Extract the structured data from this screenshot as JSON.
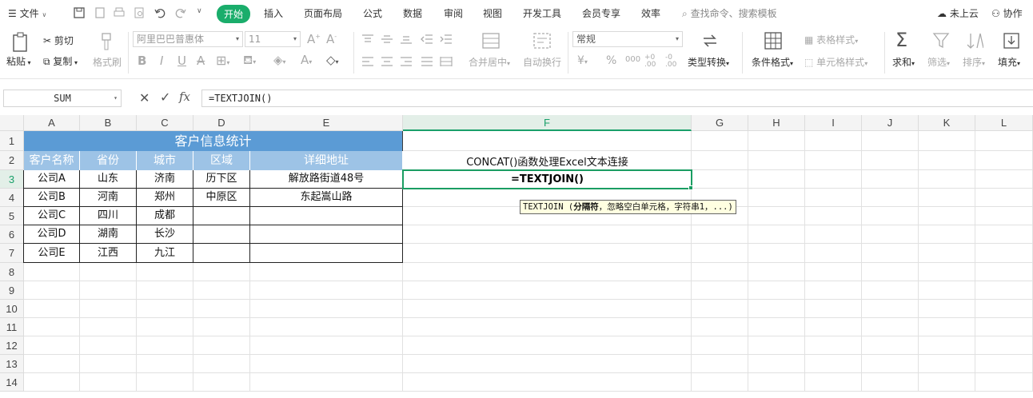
{
  "menubar": {
    "file_label": "文件",
    "tabs": [
      "开始",
      "插入",
      "页面布局",
      "公式",
      "数据",
      "审阅",
      "视图",
      "开发工具",
      "会员专享",
      "效率"
    ],
    "active_tab": "开始",
    "search_placeholder": "查找命令、搜索模板",
    "cloud_label": "未上云",
    "collab_label": "协作"
  },
  "ribbon": {
    "paste": "粘贴",
    "cut": "剪切",
    "copy": "复制",
    "format_painter": "格式刷",
    "font_name": "阿里巴巴普惠体",
    "font_size": "11",
    "merge_center": "合并居中",
    "wrap_text": "自动换行",
    "number_format": "常规",
    "type_convert": "类型转换",
    "cond_format": "条件格式",
    "table_style": "表格样式",
    "cell_style": "单元格样式",
    "sum": "求和",
    "filter": "筛选",
    "sort": "排序",
    "fill": "填充"
  },
  "formula_bar": {
    "name_box": "SUM",
    "formula": "=TEXTJOIN()"
  },
  "grid": {
    "columns": [
      "A",
      "B",
      "C",
      "D",
      "E",
      "F",
      "G",
      "H",
      "I",
      "J",
      "K",
      "L"
    ],
    "rows": [
      "1",
      "2",
      "3",
      "4",
      "5",
      "6",
      "7",
      "8",
      "9",
      "10",
      "11",
      "12",
      "13",
      "14"
    ],
    "selected_column": "F",
    "selected_row": "3"
  },
  "table": {
    "title": "客户信息统计",
    "headers": [
      "客户名称",
      "省份",
      "城市",
      "区域",
      "详细地址"
    ],
    "rows": [
      [
        "公司A",
        "山东",
        "济南",
        "历下区",
        "解放路街道48号"
      ],
      [
        "公司B",
        "河南",
        "郑州",
        "中原区",
        "东起嵩山路"
      ],
      [
        "公司C",
        "四川",
        "成都",
        "",
        ""
      ],
      [
        "公司D",
        "湖南",
        "长沙",
        "",
        ""
      ],
      [
        "公司E",
        "江西",
        "九江",
        "",
        ""
      ]
    ]
  },
  "f2_text": "CONCAT()函数处理Excel文本连接",
  "f3_text": "=TEXTJOIN()",
  "tooltip": {
    "func": "TEXTJOIN (",
    "bold_arg": "分隔符",
    "rest": "，忽略空白单元格，字符串1，...)"
  }
}
